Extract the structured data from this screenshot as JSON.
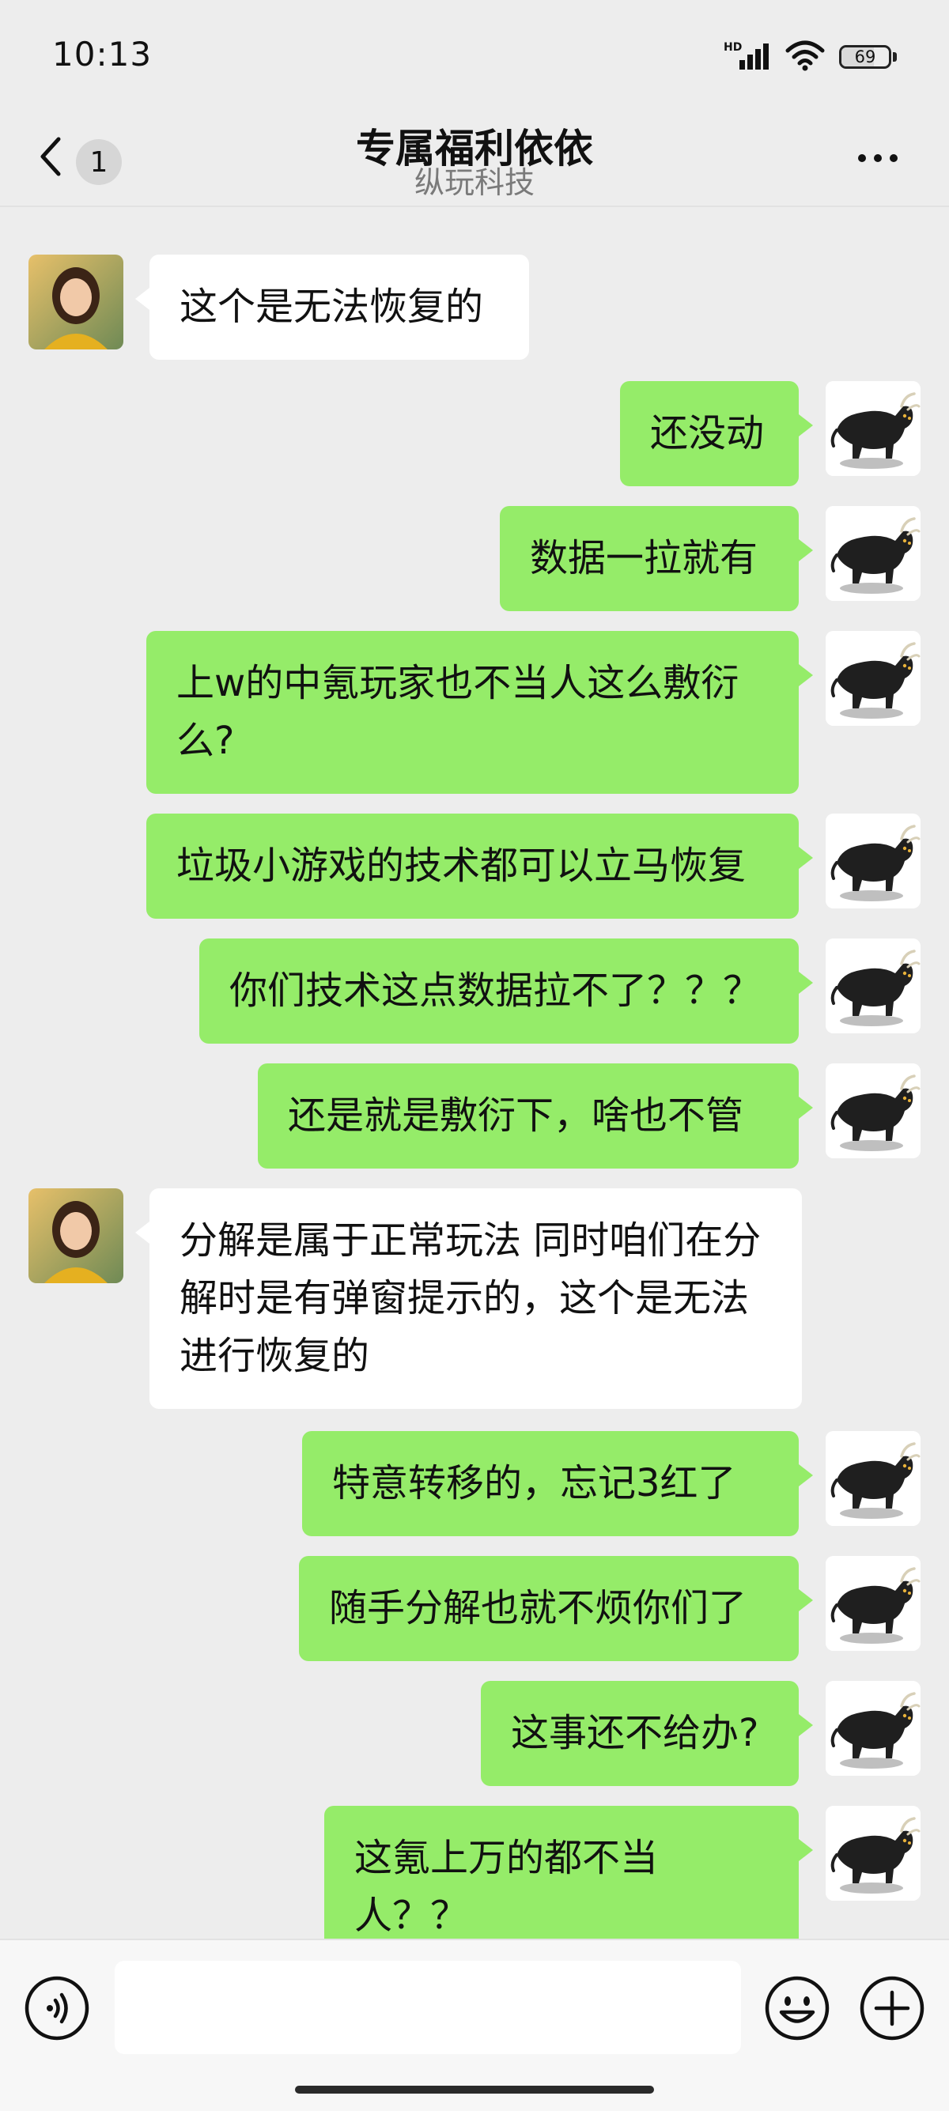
{
  "status_bar": {
    "time": "10:13",
    "network_label": "HD",
    "battery_level": "69"
  },
  "header": {
    "unread_count": "1",
    "title": "专属福利依依",
    "subtitle": "纵玩科技"
  },
  "messages": [
    {
      "side": "in",
      "text": "这个是无法恢复的"
    },
    {
      "side": "out",
      "text": "还没动"
    },
    {
      "side": "out",
      "text": "数据一拉就有"
    },
    {
      "side": "out",
      "text": "上w的中氪玩家也不当人这么敷衍么?"
    },
    {
      "side": "out",
      "text": "垃圾小游戏的技术都可以立马恢复"
    },
    {
      "side": "out",
      "text": "你们技术这点数据拉不了？？？"
    },
    {
      "side": "out",
      "text": "还是就是敷衍下，啥也不管"
    },
    {
      "side": "in",
      "text": "分解是属于正常玩法  同时咱们在分解时是有弹窗提示的，这个是无法进行恢复的"
    },
    {
      "side": "out",
      "text": "特意转移的，忘记3红了"
    },
    {
      "side": "out",
      "text": "随手分解也就不烦你们了"
    },
    {
      "side": "out",
      "text": "这事还不给办?"
    },
    {
      "side": "out",
      "text": "这氪上万的都不当人？？"
    }
  ],
  "input_bar": {
    "placeholder": "",
    "value": ""
  },
  "icons": {
    "back": "chevron-left-icon",
    "more": "more-dots-icon",
    "voice": "voice-icon",
    "emoji": "emoji-icon",
    "plus": "plus-icon"
  },
  "colors": {
    "background": "#ededed",
    "outgoing_bubble": "#95ec69",
    "incoming_bubble": "#ffffff"
  }
}
